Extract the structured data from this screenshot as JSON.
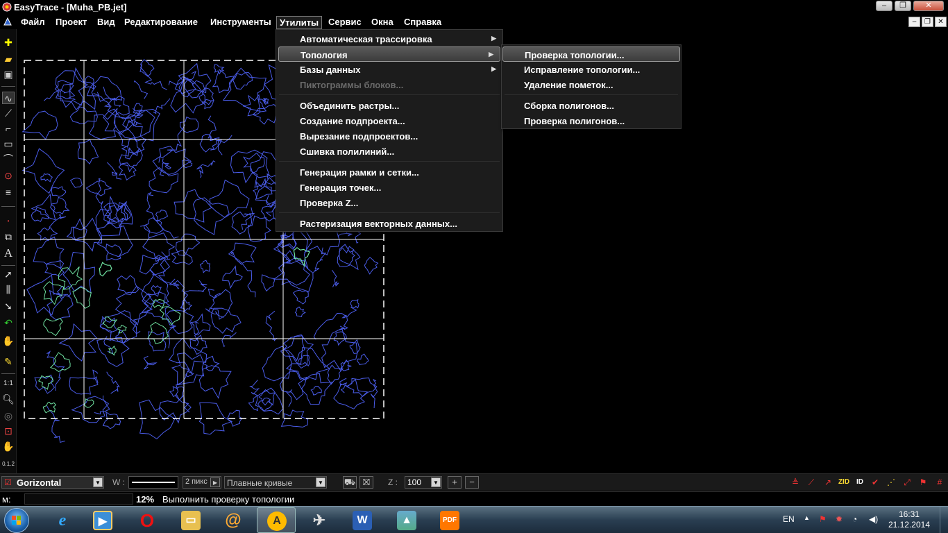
{
  "window": {
    "title": "EasyTrace - [Muha_PB.jet]"
  },
  "menubar": [
    "Файл",
    "Проект",
    "Вид",
    "Редактирование",
    "Инструменты",
    "Утилиты",
    "Сервис",
    "Окна",
    "Справка"
  ],
  "utilities_menu": [
    {
      "label": "Автоматическая трассировка",
      "submenu": true
    },
    {
      "label": "Топология",
      "submenu": true,
      "highlighted": true
    },
    {
      "label": "Базы данных",
      "submenu": true
    },
    {
      "label": "Пиктограммы блоков...",
      "disabled": true
    },
    {
      "label": "Объединить растры..."
    },
    {
      "label": "Создание подпроекта..."
    },
    {
      "label": "Вырезание подпроектов..."
    },
    {
      "label": "Сшивка полилиний..."
    },
    {
      "label": "Генерация рамки и сетки..."
    },
    {
      "label": "Генерация точек..."
    },
    {
      "label": "Проверка Z..."
    },
    {
      "label": "Растеризация векторных данных..."
    }
  ],
  "topology_submenu": [
    {
      "label": "Проверка топологии...",
      "highlighted": true
    },
    {
      "label": "Исправление топологии..."
    },
    {
      "label": "Удаление пометок..."
    },
    {
      "label": "Сборка полигонов..."
    },
    {
      "label": "Проверка полигонов..."
    }
  ],
  "bottom_toolbar": {
    "layer": "Gorizontal",
    "width_label": "W :",
    "width_value": "2 пикс",
    "curve_mode": "Плавные кривые",
    "z_label": "Z :",
    "zoom_value": "100",
    "plus": "+",
    "minus": "−",
    "zid_label": "ZID",
    "id_label": "ID"
  },
  "statusbar": {
    "mode": "м:",
    "progress": "12%",
    "message": "Выполнить проверку топологии"
  },
  "taskbar": {
    "language": "EN",
    "time": "16:31",
    "date": "21.12.2014"
  },
  "colors": {
    "contour_blue": "#4a5ce8",
    "contour_green": "#6fe0a0",
    "frame": "#ffffff",
    "menu_bg": "#1c1c1c"
  }
}
